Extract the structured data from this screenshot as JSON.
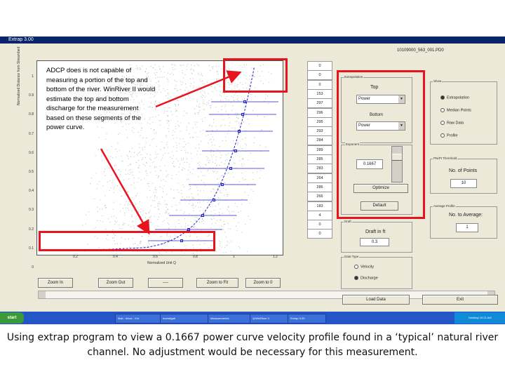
{
  "window": {
    "title": "Extrap 3.00",
    "file_label": "10109000_563_001.PD0"
  },
  "plot": {
    "y_title": "Normalized Distance from Streambed",
    "x_title": "Normalized Unit Q",
    "y_ticks": [
      "1",
      "0.9",
      "0.8",
      "0.7",
      "0.6",
      "0.5",
      "0.4",
      "0.3",
      "0.2",
      "0.1",
      "0"
    ],
    "x_ticks": [
      "0.2",
      "0.4",
      "0.6",
      "0.8",
      "1",
      "1.2"
    ]
  },
  "annotation": "ADCP does is not capable of measuring a portion of the top and bottom of the river. WinRiver II would estimate the top and bottom discharge for the measurement based on these segments of the power curve.",
  "list_values": [
    "0",
    "0",
    "0",
    "153",
    "297",
    "296",
    "295",
    "293",
    "284",
    "289",
    "285",
    "283",
    "264",
    "286",
    "266",
    "183",
    "4",
    "0",
    "0"
  ],
  "extrapolation": {
    "title": "Extrapolation",
    "top_label": "Top",
    "top_value": "Power",
    "bottom_label": "Bottom",
    "bottom_value": "Power"
  },
  "exponent": {
    "title": "Exponent",
    "value": "0.1667",
    "optimize": "Optimize",
    "default": "Default"
  },
  "show": {
    "title": "Show",
    "options": [
      "Extrapolation",
      "Median Points",
      "Raw Data",
      "Profile"
    ],
    "selected": 0
  },
  "points": {
    "title": "Pts/Pt Threshold",
    "label": "No. of Points",
    "value": "10"
  },
  "average": {
    "title": "Average Profile",
    "label": "No. to Average:",
    "value": "1"
  },
  "depth": {
    "title": "Draft",
    "label": "Draft in ft",
    "value": "0.3"
  },
  "data_type": {
    "title": "Data Type",
    "options": [
      "Velocity",
      "Discharge"
    ],
    "selected": 1
  },
  "buttons": {
    "zoom_in": "Zoom In",
    "zoom_out": "Zoom Out",
    "blank": "----",
    "zoom_to_fit": "Zoom to Fit",
    "zoom_to_0": "Zoom to 0",
    "load_data": "Load Data",
    "exit": "Exit"
  },
  "taskbar": {
    "start": "start",
    "tasks": [
      "Mail - Inbox - Ext",
      "Investigati",
      "Measurements",
      "Q/WinRiver II",
      "Extrap 3.00"
    ],
    "tray": "Desktop 10:21 AM"
  },
  "caption": "Using extrap program to view a 0.1667 power curve velocity profile found in a ‘typical’ natural river channel. No adjustment would be necessary for this measurement.",
  "colors": {
    "highlight_red": "#e8141d",
    "curve_blue": "#2323c8",
    "title_blue": "#0a246a"
  }
}
